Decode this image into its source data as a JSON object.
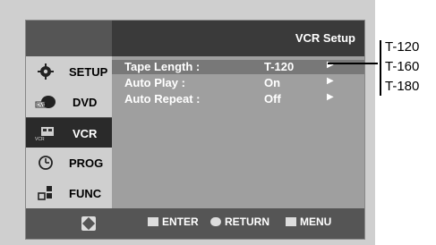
{
  "screen": {
    "title": "VCR Setup",
    "sidebar": {
      "items": [
        {
          "label": "SETUP",
          "icon": "gear-icon",
          "state": "normal"
        },
        {
          "label": "DVD",
          "icon": "dvd-icon",
          "state": "normal"
        },
        {
          "label": "VCR",
          "icon": "vcr-icon",
          "state": "selected"
        },
        {
          "label": "PROG",
          "icon": "timer-icon",
          "state": "normal"
        },
        {
          "label": "FUNC",
          "icon": "function-icon",
          "state": "normal"
        }
      ]
    },
    "settings": [
      {
        "label": "Tape Length :",
        "value": "T-120",
        "arrow": "▶"
      },
      {
        "label": "Auto Play :",
        "value": "On",
        "arrow": "▶"
      },
      {
        "label": "Auto Repeat :",
        "value": "Off",
        "arrow": "▶"
      }
    ],
    "bottom_bar": {
      "enter": "ENTER",
      "return": "RETURN",
      "menu": "MENU"
    }
  },
  "callout": {
    "options": [
      "T-120",
      "T-160",
      "T-180"
    ]
  }
}
